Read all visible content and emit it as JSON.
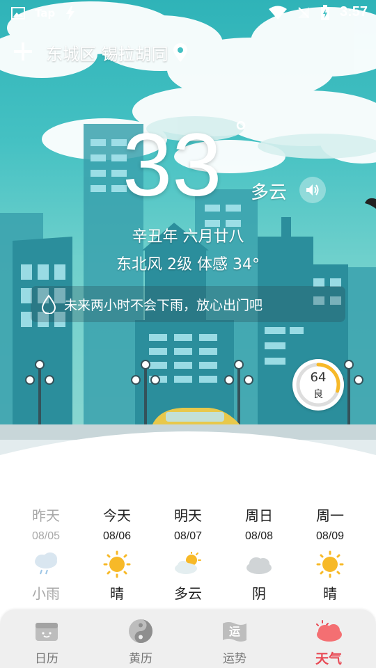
{
  "status_bar": {
    "tap_label": "Tap",
    "time": "3:57"
  },
  "location": {
    "name": "东城区 锡拉胡同"
  },
  "weather": {
    "temperature": "33",
    "degree_symbol": "°",
    "condition": "多云",
    "lunar_date": "辛丑年 六月廿八",
    "wind_feel": "东北风 2级  体感 34°",
    "rain_notice": "未来两小时不会下雨，放心出门吧"
  },
  "aqi": {
    "value": "64",
    "level": "良",
    "fraction": 0.3
  },
  "forecast": [
    {
      "name": "昨天",
      "date": "08/05",
      "condition": "小雨",
      "icon": "light-rain-icon"
    },
    {
      "name": "今天",
      "date": "08/06",
      "condition": "晴",
      "icon": "sunny-icon"
    },
    {
      "name": "明天",
      "date": "08/07",
      "condition": "多云",
      "icon": "partly-cloudy-icon"
    },
    {
      "name": "周日",
      "date": "08/08",
      "condition": "阴",
      "icon": "overcast-icon"
    },
    {
      "name": "周一",
      "date": "08/09",
      "condition": "晴",
      "icon": "sunny-icon"
    }
  ],
  "tabs": [
    {
      "label": "日历",
      "icon": "calendar-icon",
      "active": false
    },
    {
      "label": "黄历",
      "icon": "yin-yang-icon",
      "active": false
    },
    {
      "label": "运势",
      "icon": "fortune-flag-icon",
      "active": false,
      "icon_text": "运"
    },
    {
      "label": "天气",
      "icon": "weather-cloud-icon",
      "active": true
    }
  ],
  "colors": {
    "active_tab": "#e84a55",
    "sky": "#45c1c3",
    "sun": "#f7b928"
  }
}
